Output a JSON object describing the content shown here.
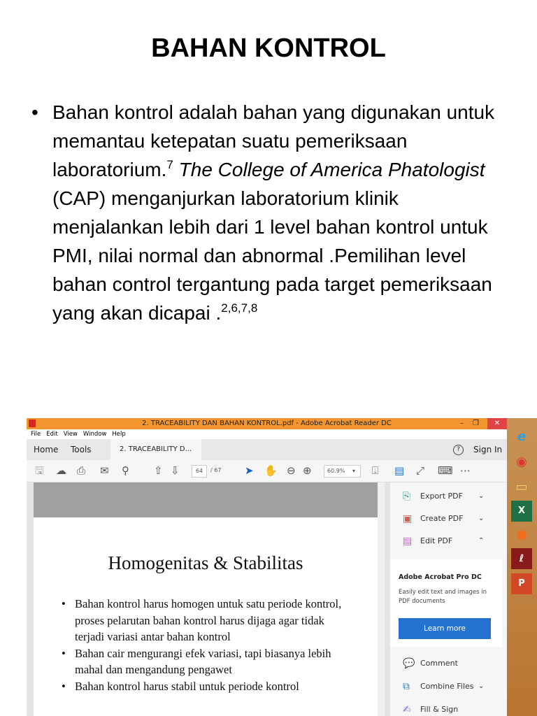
{
  "slide": {
    "title": "BAHAN KONTROL",
    "bullet": {
      "p1": "Bahan kontrol adalah bahan yang digunakan untuk memantau ketepatan suatu pemeriksaan laboratorium.",
      "sup1": "7",
      "italic": "The College of America Phatologist",
      "p2": " (CAP) menganjurkan laboratorium klinik menjalankan lebih dari 1 level bahan kontrol untuk PMI, nilai normal dan abnormal .Pemilihan level bahan control tergantung pada target pemeriksaan yang akan dicapai .",
      "sup2": "2,6,7,8"
    }
  },
  "window": {
    "title": "2. TRACEABILITY DAN BAHAN KONTROL.pdf - Adobe Acrobat Reader DC",
    "menu": [
      "File",
      "Edit",
      "View",
      "Window",
      "Help"
    ],
    "tabs": {
      "home": "Home",
      "tools": "Tools",
      "doc": "2. TRACEABILITY D...",
      "close": "×",
      "help": "?",
      "signin": "Sign In"
    },
    "toolbar": {
      "page": "64",
      "total": "/ 67",
      "zoom": "60.9%"
    },
    "document": {
      "heading": "Homogenitas & Stabilitas",
      "bullets": [
        "Bahan kontrol harus homogen untuk satu periode kontrol, proses pelarutan bahan kontrol harus dijaga agar tidak terjadi variasi antar bahan kontrol",
        "Bahan cair mengurangi efek variasi, tapi biasanya lebih mahal dan mengandung pengawet",
        "Bahan kontrol harus stabil untuk periode kontrol"
      ]
    },
    "panel": {
      "export": "Export PDF",
      "create": "Create PDF",
      "edit": "Edit PDF",
      "promo_title": "Adobe Acrobat Pro DC",
      "promo_desc": "Easily edit text and images in PDF documents",
      "learn": "Learn more",
      "comment": "Comment",
      "combine": "Combine Files",
      "fill": "Fill & Sign"
    }
  },
  "colors": {
    "titlebar": "#f3962f",
    "accent": "#2573d0"
  }
}
